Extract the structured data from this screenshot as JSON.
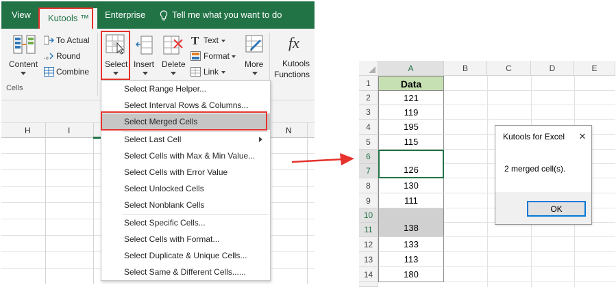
{
  "ribbon_tabs": {
    "view": "View",
    "kutools": "Kutools ™",
    "enterprise": "Enterprise",
    "tell_me": "Tell me what you want to do"
  },
  "ribbon": {
    "content": "Content",
    "to_actual": "To Actual",
    "round": "Round",
    "combine": "Combine",
    "select": "Select",
    "insert": "Insert",
    "delete": "Delete",
    "text": "Text",
    "format": "Format",
    "link": "Link",
    "more": "More",
    "kutools_functions_1": "Kutools",
    "kutools_functions_2": "Functions",
    "fx": "fx",
    "group_cells": "Cells"
  },
  "left_sheet": {
    "columns": [
      "H",
      "I",
      "N"
    ]
  },
  "select_menu": {
    "items": [
      "Select Range Helper...",
      "Select Interval Rows & Columns...",
      "Select Merged Cells",
      "Select Last Cell",
      "Select Cells with Max & Min Value...",
      "Select Cells with Error Value",
      "Select Unlocked Cells",
      "Select Nonblank Cells",
      "Select Specific Cells...",
      "Select Cells with Format...",
      "Select Duplicate & Unique Cells...",
      "Select Same & Different Cells......"
    ],
    "highlighted_index": 2
  },
  "right_sheet": {
    "columns": [
      "A",
      "B",
      "C",
      "D",
      "E"
    ],
    "rows": [
      "1",
      "2",
      "3",
      "4",
      "5",
      "6",
      "7",
      "8",
      "9",
      "10",
      "11",
      "12",
      "13",
      "14"
    ],
    "header": "Data",
    "values": [
      "121",
      "119",
      "195",
      "115",
      "126",
      "130",
      "111",
      "138",
      "133",
      "113",
      "180"
    ]
  },
  "dialog": {
    "title": "Kutools for Excel",
    "close": "✕",
    "message": "2 merged cell(s).",
    "ok": "OK"
  },
  "colors": {
    "excel_green": "#217346",
    "highlight_red": "#e5322d",
    "header_fill": "#c6e0b4",
    "merged_fill": "#d0d0d0"
  }
}
